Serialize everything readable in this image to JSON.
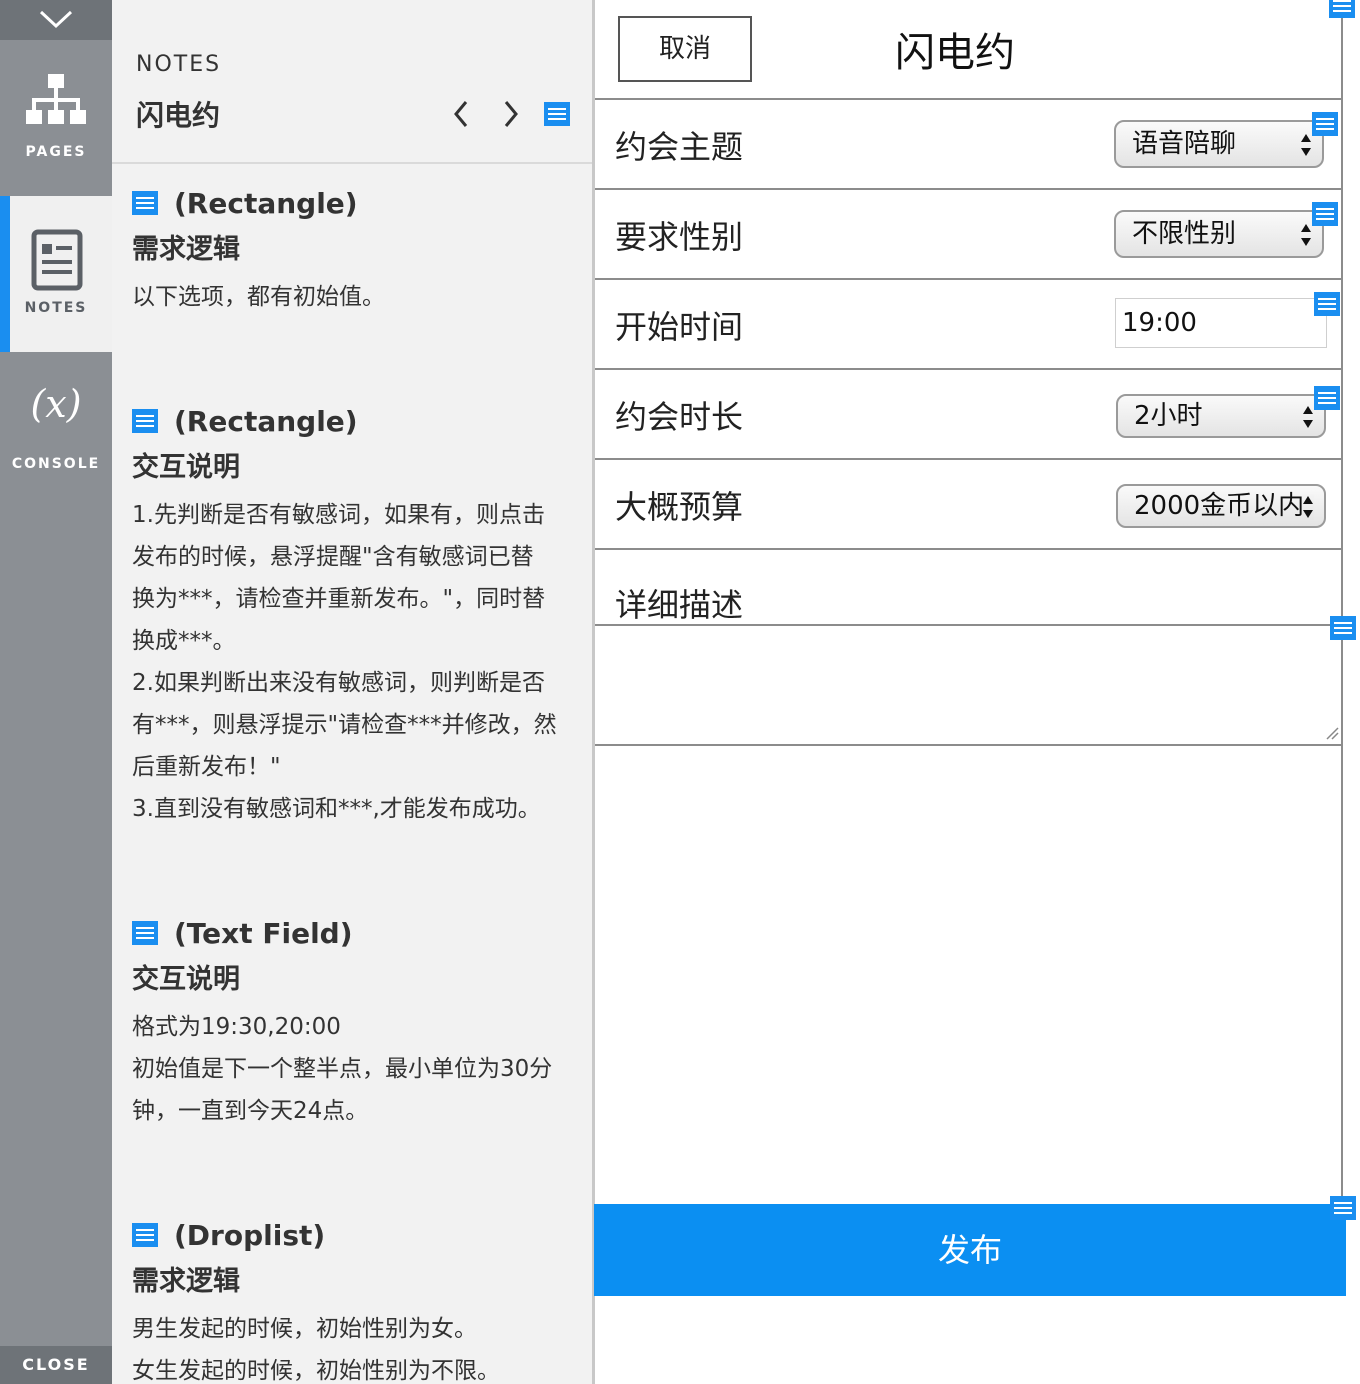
{
  "sidebar": {
    "tabs": [
      {
        "label": "PAGES",
        "icon": "sitemap-icon"
      },
      {
        "label": "NOTES",
        "icon": "document-icon"
      },
      {
        "label": "CONSOLE",
        "icon": "variable-icon",
        "glyph": "(x)"
      }
    ],
    "close_label": "CLOSE"
  },
  "notes_panel": {
    "caption": "NOTES",
    "page_name": "闪电约",
    "notes": [
      {
        "widget_type": "(Rectangle)",
        "heading": "需求逻辑",
        "body": "以下选项，都有初始值。"
      },
      {
        "widget_type": "(Rectangle)",
        "heading": "交互说明",
        "body": "1.先判断是否有敏感词，如果有，则点击\n发布的时候，悬浮提醒\"含有敏感词已替\n换为***，请检查并重新发布。\"，同时替\n换成***。\n2.如果判断出来没有敏感词，则判断是否\n有***，则悬浮提示\"请检查***并修改，然\n后重新发布！\"\n3.直到没有敏感词和***,才能发布成功。"
      },
      {
        "widget_type": "(Text Field)",
        "heading": "交互说明",
        "body": "格式为19:30,20:00\n初始值是下一个整半点，最小单位为30分\n钟，一直到今天24点。"
      },
      {
        "widget_type": "(Droplist)",
        "heading": "需求逻辑",
        "body": "男生发起的时候，初始性别为女。\n女生发起的时候，初始性别为不限。"
      }
    ]
  },
  "prototype": {
    "cancel_label": "取消",
    "title": "闪电约",
    "rows": [
      {
        "label": "约会主题",
        "value": "语音陪聊"
      },
      {
        "label": "要求性别",
        "value": "不限性别"
      },
      {
        "label": "开始时间",
        "value": "19:00"
      },
      {
        "label": "约会时长",
        "value": "2小时"
      },
      {
        "label": "大概预算",
        "value": "2000金币以内"
      }
    ],
    "description_label": "详细描述",
    "submit_label": "发布"
  },
  "colors": {
    "accent": "#1a8ef0",
    "submit": "#0b8ff2",
    "rail": "#8b8f94"
  }
}
